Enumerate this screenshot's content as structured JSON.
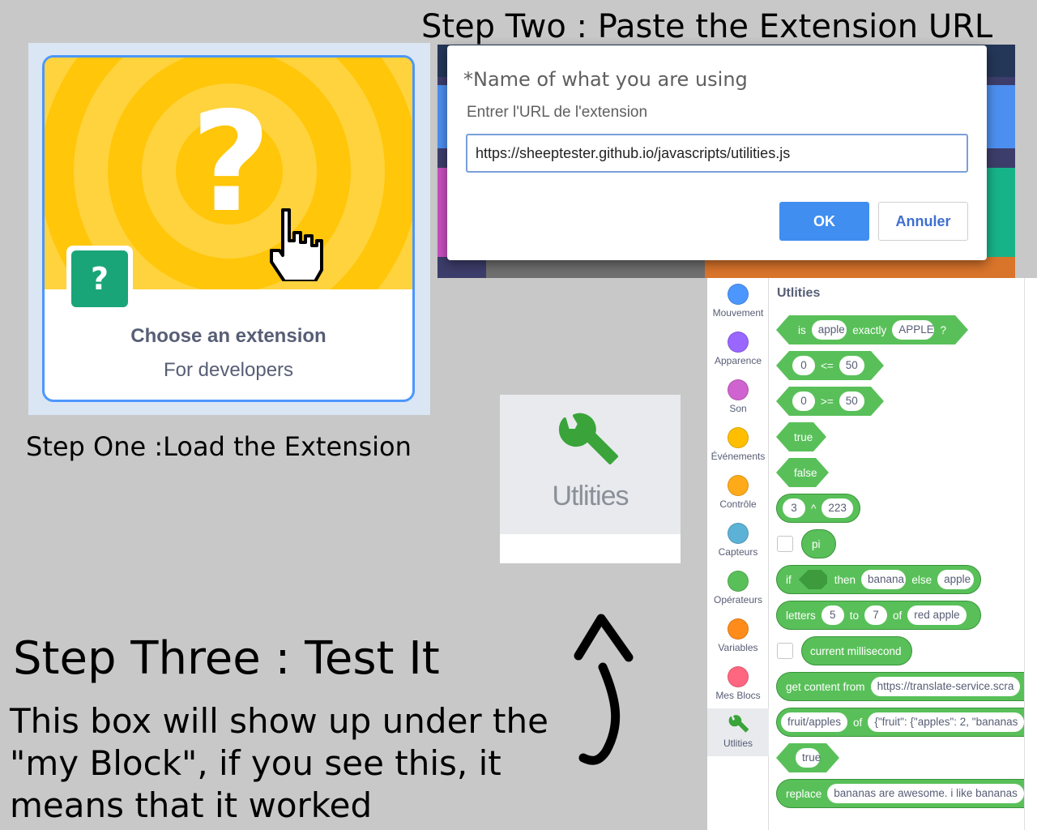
{
  "captions": {
    "step_one": "Step One :Load the Extension",
    "step_two": "Step Two : Paste the Extension URL",
    "step_three": "Step Three : Test It",
    "body_lines": [
      "This box will show up under the",
      "\"my Block\", if you see this, it",
      "means that it worked"
    ]
  },
  "extension_card": {
    "icon_glyph": "?",
    "small_icon_glyph": "?",
    "title": "Choose an extension",
    "subtitle": "For developers",
    "cursor_icon": "hand-pointer-icon"
  },
  "dialog": {
    "title": "*Name of what you are using",
    "label": "Entrer l'URL de l'extension",
    "input_value": "https://sheeptester.github.io/javascripts/utilities.js",
    "ok_label": "OK",
    "cancel_label": "Annuler"
  },
  "zoomed_category": {
    "icon": "wrench-icon",
    "label": "Utlities"
  },
  "palette": {
    "title": "Utlities",
    "categories": [
      {
        "label": "Mouvement",
        "color": "#4c97ff"
      },
      {
        "label": "Apparence",
        "color": "#9966ff"
      },
      {
        "label": "Son",
        "color": "#cf63cf"
      },
      {
        "label": "Événements",
        "color": "#ffbf00"
      },
      {
        "label": "Contrôle",
        "color": "#ffab19"
      },
      {
        "label": "Capteurs",
        "color": "#5cb1d6"
      },
      {
        "label": "Opérateurs",
        "color": "#59c059"
      },
      {
        "label": "Variables",
        "color": "#ff8c1a"
      },
      {
        "label": "Mes Blocs",
        "color": "#ff6680"
      },
      {
        "label": "Utlities",
        "color": "#59c059"
      }
    ],
    "blocks": {
      "exactly": {
        "t1": "is",
        "a": "apple",
        "t2": "exactly",
        "b": "APPLE",
        "t3": "?"
      },
      "lte": {
        "a": "0",
        "op": "<=",
        "b": "50"
      },
      "gte": {
        "a": "0",
        "op": ">=",
        "b": "50"
      },
      "true1": "true",
      "false1": "false",
      "power": {
        "a": "3",
        "op": "^",
        "b": "223"
      },
      "pi": "pi",
      "ifthen": {
        "t1": "if",
        "t2": "then",
        "a": "banana",
        "t3": "else",
        "b": "apple"
      },
      "letters": {
        "t1": "letters",
        "a": "5",
        "t2": "to",
        "b": "7",
        "t3": "of",
        "c": "red apple"
      },
      "millis": "current millisecond",
      "getcontent": {
        "t1": "get content from",
        "a": "https://translate-service.scra"
      },
      "json": {
        "a": "fruit/apples",
        "t1": "of",
        "b": "{\"fruit\": {\"apples\": 2, \"bananas"
      },
      "true2": "true",
      "replace": {
        "t1": "replace",
        "a": "bananas are awesome. i like bananas"
      }
    }
  },
  "colors": {
    "background": "#c8c8c8",
    "block_green": "#59c059",
    "dialog_ok": "#3f8ef0",
    "extension_yellow": "#ffbf00",
    "extension_teal": "#1aa579"
  }
}
